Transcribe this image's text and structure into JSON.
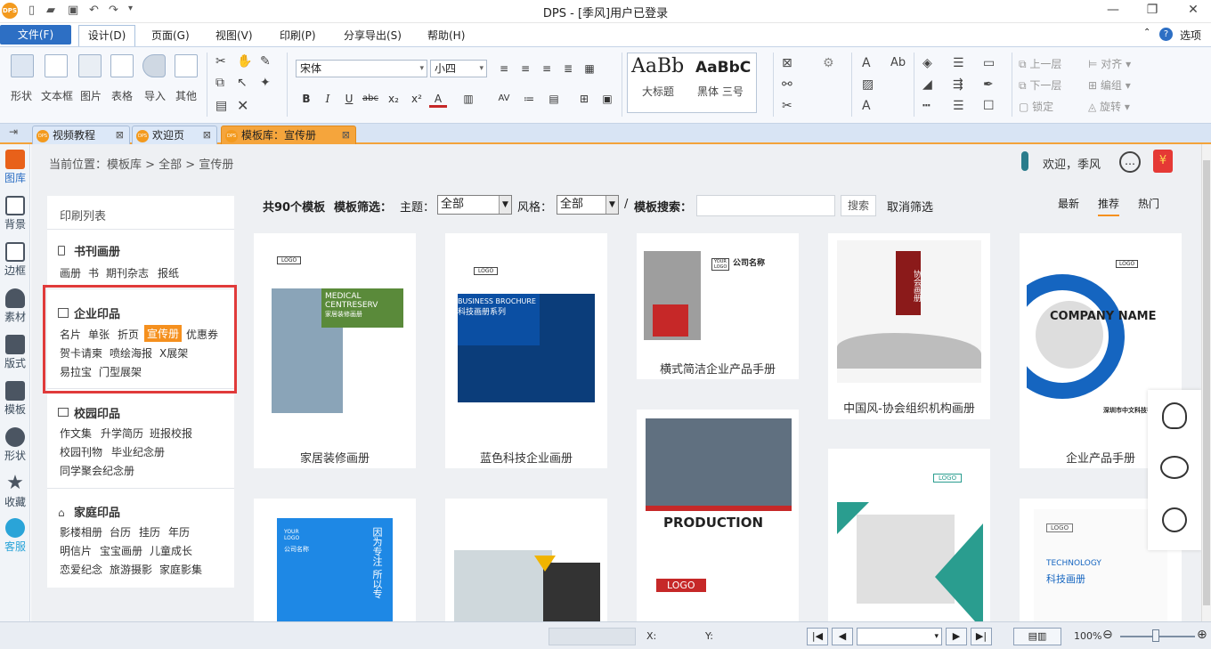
{
  "titlebar": {
    "title": "DPS - [季风]用户已登录",
    "app_logo": "DPS",
    "quick_access_icons": [
      "new-icon",
      "open-folder-icon",
      "save-icon",
      "undo-icon",
      "redo-icon",
      "dropdown-icon"
    ],
    "window_controls": {
      "minimize": "—",
      "maximize": "❐",
      "close": "✕"
    }
  },
  "menubar": {
    "items": [
      "文件(F)",
      "设计(D)",
      "页面(G)",
      "视图(V)",
      "印刷(P)",
      "分享导出(S)",
      "帮助(H)"
    ],
    "right": {
      "options": "选项",
      "help": "?"
    }
  },
  "ribbon": {
    "insert_group": [
      "形状",
      "文本框",
      "图片",
      "表格",
      "导入",
      "其他"
    ],
    "font_name": "宋体",
    "font_size": "小四",
    "style_gallery": [
      {
        "preview": "AaBb",
        "label": "大标题"
      },
      {
        "preview": "AaBbC",
        "label": "黑体  三号"
      }
    ],
    "arrange_group": [
      "上一层",
      "下一层",
      "锁定",
      "对齐",
      "编组",
      "旋转"
    ]
  },
  "doc_tabs": [
    {
      "label": "视频教程",
      "close": "⊠"
    },
    {
      "label": "欢迎页",
      "close": "⊠"
    },
    {
      "label": "模板库：宣传册",
      "close": "⊠"
    }
  ],
  "left_nav": [
    "图库",
    "背景",
    "边框",
    "素材",
    "版式",
    "模板",
    "形状",
    "收藏",
    "客服"
  ],
  "breadcrumb": "当前位置：模板库 > 全部 > 宣传册",
  "user": {
    "welcome": "欢迎，季风"
  },
  "categories": {
    "title": "印刷列表",
    "groups": [
      {
        "name": "书刊画册",
        "items": [
          "画册",
          "书",
          "期刊杂志",
          "报纸"
        ]
      },
      {
        "name": "企业印品",
        "items": [
          "名片",
          "单张",
          "折页",
          "宣传册",
          "优惠券",
          "贺卡请柬",
          "喷绘海报",
          "X展架",
          "易拉宝",
          "门型展架"
        ],
        "selected": "宣传册"
      },
      {
        "name": "校园印品",
        "items": [
          "作文集",
          "升学简历",
          "班报校报",
          "校园刊物",
          "毕业纪念册",
          "同学聚会纪念册"
        ]
      },
      {
        "name": "家庭印品",
        "items": [
          "影楼相册",
          "台历",
          "挂历",
          "年历",
          "明信片",
          "宝宝画册",
          "儿童成长",
          "恋爱纪念",
          "旅游摄影",
          "家庭影集"
        ]
      }
    ]
  },
  "filter": {
    "count": "共90个模板",
    "filter_label": "模板筛选：",
    "theme_label": "主题：",
    "theme_value": "全部",
    "style_label": "风格：",
    "style_value": "全部",
    "slash": "/",
    "search_label": "模板搜索：",
    "search_value": "",
    "search_button": "搜索",
    "clear": "取消筛选",
    "sort": [
      "最新",
      "推荐",
      "热门"
    ],
    "sort_active": "推荐"
  },
  "templates": [
    {
      "caption": "家居装修画册",
      "thumb_title": "MEDICAL CENTRESERV",
      "thumb_sub": "家居装修画册",
      "logo": "LOGO",
      "accent": "#5a8a3a"
    },
    {
      "caption": "蓝色科技企业画册",
      "thumb_title": "BUSINESS BROCHURE",
      "thumb_sub": "科技画册系列",
      "logo": "LOGO",
      "accent": "#0b4fa3"
    },
    {
      "caption": "横式简洁企业产品手册",
      "thumb_title": "公司名称",
      "logo": "YOUR LOGO",
      "accent": "#c62828"
    },
    {
      "caption": "中国风-协会组织机构画册",
      "thumb_title": "协会画册",
      "accent": "#8b1a1a"
    },
    {
      "caption": "企业产品手册",
      "thumb_title": "COMPANY NAME",
      "thumb_sub": "深圳市中文科技有限公司",
      "logo": "LOGO",
      "accent": "#1565c0"
    },
    {
      "caption": "",
      "thumb_title": "因为专注  所以专",
      "thumb_sub": "公司名称",
      "logo": "YOUR LOGO",
      "accent": "#1e88e5"
    },
    {
      "caption": "",
      "accent": "#f0b400"
    },
    {
      "caption": "",
      "thumb_title": "PRODUCTION",
      "logo": "LOGO",
      "accent": "#c62828"
    },
    {
      "caption": "",
      "logo": "LOGO",
      "accent": "#2a9d8f"
    },
    {
      "caption": "",
      "thumb_title": "TECHNOLOGY",
      "thumb_sub": "科技画册",
      "logo": "LOGO",
      "accent": "#90a4ae"
    }
  ],
  "float_panel": [
    "qq-icon",
    "wechat-icon",
    "headset-icon"
  ],
  "statusbar": {
    "x_label": "X:",
    "y_label": "Y:",
    "zoom": "100%"
  },
  "colors": {
    "accent": "#f5901e",
    "brand_blue": "#2d6fc4",
    "highlight": "#e03a3a"
  }
}
